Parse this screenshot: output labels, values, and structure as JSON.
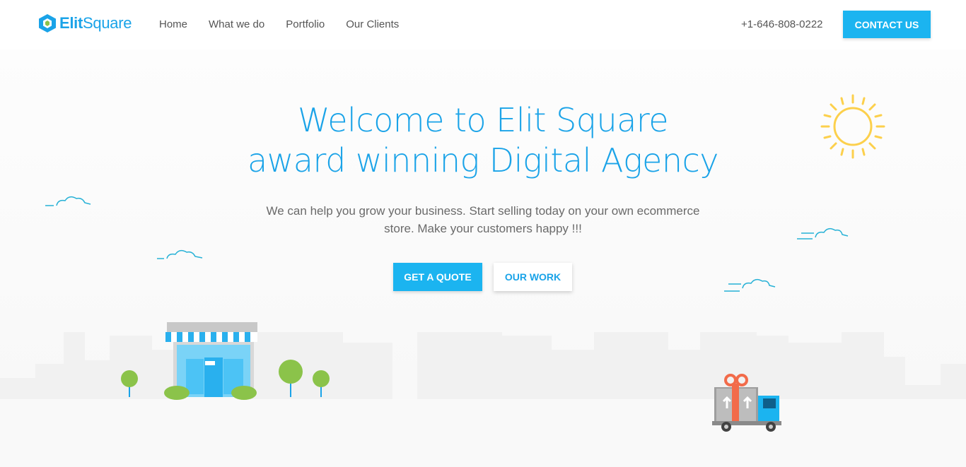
{
  "header": {
    "logo_text_bold": "Elit",
    "logo_text_light": "Square",
    "nav": [
      {
        "label": "Home"
      },
      {
        "label": "What we do"
      },
      {
        "label": "Portfolio"
      },
      {
        "label": "Our Clients"
      }
    ],
    "phone": "+1-646-808-0222",
    "contact_label": "CONTACT US"
  },
  "hero": {
    "title_line1": "Welcome to Elit Square",
    "title_line2": "award winning Digital Agency",
    "subtitle_line1": "We can help you grow your business. Start selling today on your own ecommerce",
    "subtitle_line2": "store. Make your customers happy !!!",
    "quote_label": "GET A QUOTE",
    "work_label": "OUR WORK"
  },
  "colors": {
    "accent": "#1bb4f0",
    "title": "#1aa3e8",
    "sun": "#fcd04c",
    "tree": "#8bc34a",
    "cloud": "#26b1d6",
    "gift_ribbon": "#f26b4a"
  },
  "icons": {
    "logo": "hexagon-logo-icon",
    "sun": "sun-icon",
    "cloud": "cloud-icon",
    "shop": "storefront-icon",
    "tree": "tree-icon",
    "truck": "delivery-truck-icon"
  }
}
